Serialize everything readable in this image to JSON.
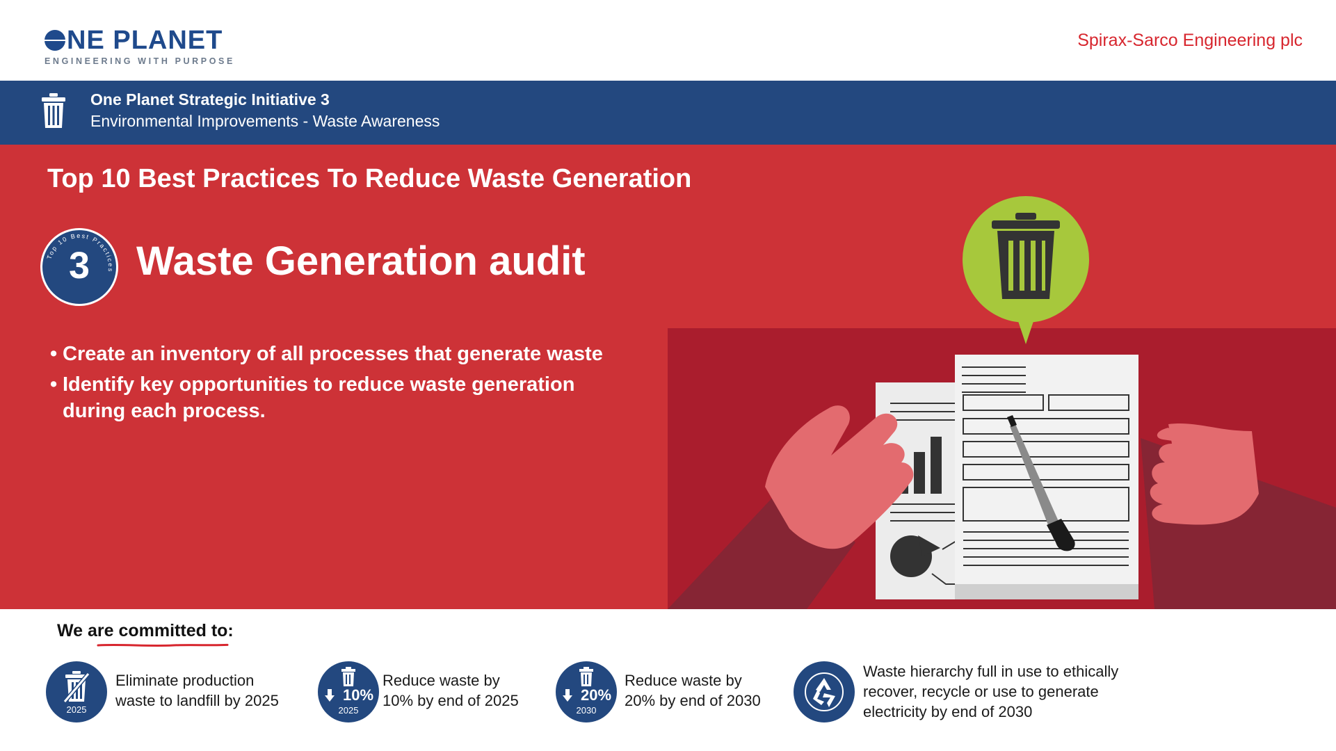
{
  "header": {
    "logo_main": "NE PLANET",
    "logo_sub": "ENGINEERING WITH PURPOSE",
    "company": "Spirax-Sarco Engineering plc"
  },
  "band": {
    "title": "One Planet Strategic Initiative 3",
    "subtitle": "Environmental Improvements - Waste Awareness",
    "icon": "trash-can-icon"
  },
  "main": {
    "section_title": "Top 10 Best Practices To Reduce Waste Generation",
    "badge_number": "3",
    "badge_ring_text": "Top 10 Best Practices",
    "practice_title": "Waste Generation audit",
    "bullets": [
      "Create an inventory of all processes that generate waste",
      "Identify key opportunities to reduce waste generation during each process."
    ],
    "illustration_icon": "trash-can-icon",
    "colors": {
      "red": "#cd3237",
      "dark_red": "#aa1d2d",
      "navy": "#23487f",
      "green": "#a7c83c"
    }
  },
  "commitments": {
    "heading": "We are committed to:",
    "items": [
      {
        "icon": "no-landfill-icon",
        "badge_big": "",
        "badge_small": "2025",
        "text_line1": "Eliminate production",
        "text_line2": "waste to landfill by 2025",
        "text_line3": ""
      },
      {
        "icon": "reduce-10-icon",
        "badge_big": "10%",
        "badge_small": "2025",
        "text_line1": "Reduce waste by",
        "text_line2": "10% by end of 2025",
        "text_line3": ""
      },
      {
        "icon": "reduce-20-icon",
        "badge_big": "20%",
        "badge_small": "2030",
        "text_line1": "Reduce waste by",
        "text_line2": "20% by end of 2030",
        "text_line3": ""
      },
      {
        "icon": "recycle-icon",
        "badge_big": "",
        "badge_small": "",
        "text_line1": "Waste hierarchy full in use to ethically",
        "text_line2": "recover, recycle or use to generate",
        "text_line3": "electricity by end of 2030"
      }
    ]
  }
}
